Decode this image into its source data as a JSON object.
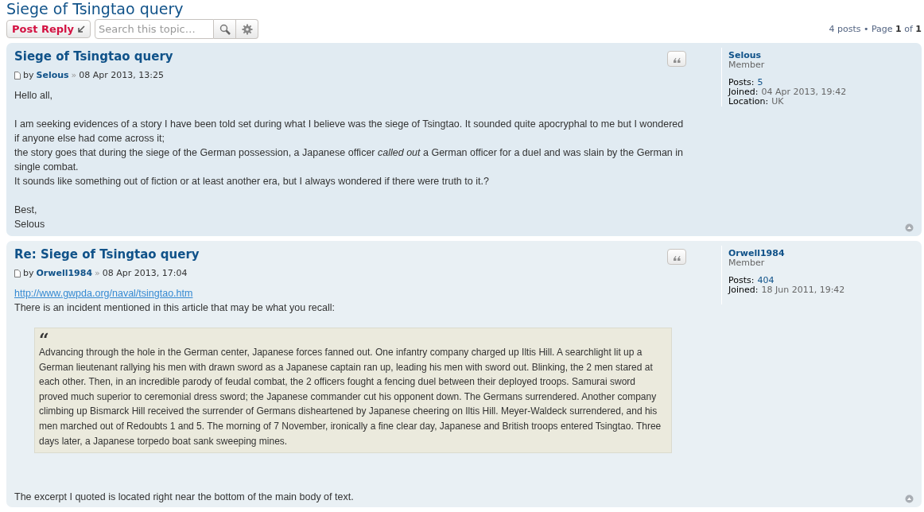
{
  "topic_title": "Siege of Tsingtao query",
  "toolbar": {
    "post_reply": "Post Reply",
    "search": {
      "placeholder": "Search this topic…"
    }
  },
  "pagination": "4 posts • Page **1** of **1**",
  "posts": [
    {
      "title": "Siege of Tsingtao query",
      "by": "by",
      "author": "Selous",
      "separator": "»",
      "date": "08 Apr 2013, 13:25",
      "body": [
        {
          "kind": "paragraph",
          "lines": [
            {
              "kind": "text",
              "text": "Hello all,"
            }
          ]
        },
        {
          "kind": "paragraph",
          "lines": [
            {
              "kind": "text",
              "text": "I am seeking evidences of a story I have been told set during what I believe was the siege of Tsingtao. It sounded quite apocryphal to me but I wondered if anyone else had come across it;"
            },
            {
              "kind": "text",
              "text": "the story goes that during the siege of the German possession, a Japanese officer *called out* a German officer for a duel and was slain by the German in single combat."
            },
            {
              "kind": "text",
              "text": "It sounds like something out of fiction or at least another era, but I always wondered if there were truth to it.?"
            }
          ]
        },
        {
          "kind": "paragraph",
          "lines": [
            {
              "kind": "text",
              "text": "Best,"
            },
            {
              "kind": "text",
              "text": "Selous"
            }
          ]
        }
      ],
      "profile": {
        "name": "Selous",
        "rank": "Member",
        "fields": [
          {
            "label": "Posts:",
            "value": "5",
            "kind": "link"
          },
          {
            "label": "Joined:",
            "value": "04 Apr 2013, 19:42",
            "kind": "text"
          },
          {
            "label": "Location:",
            "value": "UK",
            "kind": "text"
          }
        ]
      }
    },
    {
      "title": "Re: Siege of Tsingtao query",
      "by": "by",
      "author": "Orwell1984",
      "separator": "»",
      "date": "08 Apr 2013, 17:04",
      "body": [
        {
          "kind": "paragraph",
          "lines": [
            {
              "kind": "link",
              "text": "http://www.gwpda.org/naval/tsingtao.htm"
            },
            {
              "kind": "text",
              "text": "There is an incident mentioned in this article that may be what you recall:"
            }
          ]
        },
        {
          "kind": "quote",
          "mark": "“",
          "text": "Advancing through the hole in the German center, Japanese forces fanned out. One infantry company charged up Iltis Hill. A searchlight lit up a German lieutenant rallying his men with drawn sword as a Japanese captain ran up, leading his men with sword out. Blinking, the 2 men stared at each other. Then, in an incredible parody of feudal combat, the 2 officers fought a fencing duel between their deployed troops. Samurai sword proved much superior to ceremonial dress sword; the Japanese commander cut his opponent down. The Germans surrendered. Another company climbing up Bismarck Hill received the surrender of Germans disheartened by Japanese cheering on Iltis Hill. Meyer-Waldeck surrendered, and his men marched out of Redoubts 1 and 5. The morning of 7 November, ironically a fine clear day, Japanese and British troops entered Tsingtao. Three days later, a Japanese torpedo boat sank sweeping mines."
        },
        {
          "kind": "paragraph",
          "lines": [
            {
              "kind": "text",
              "text": "The excerpt I quoted is located right near the bottom of the main body of text."
            }
          ]
        }
      ],
      "profile": {
        "name": "Orwell1984",
        "rank": "Member",
        "fields": [
          {
            "label": "Posts:",
            "value": "404",
            "kind": "link"
          },
          {
            "label": "Joined:",
            "value": "18 Jun 2011, 19:42",
            "kind": "text"
          }
        ]
      }
    }
  ]
}
